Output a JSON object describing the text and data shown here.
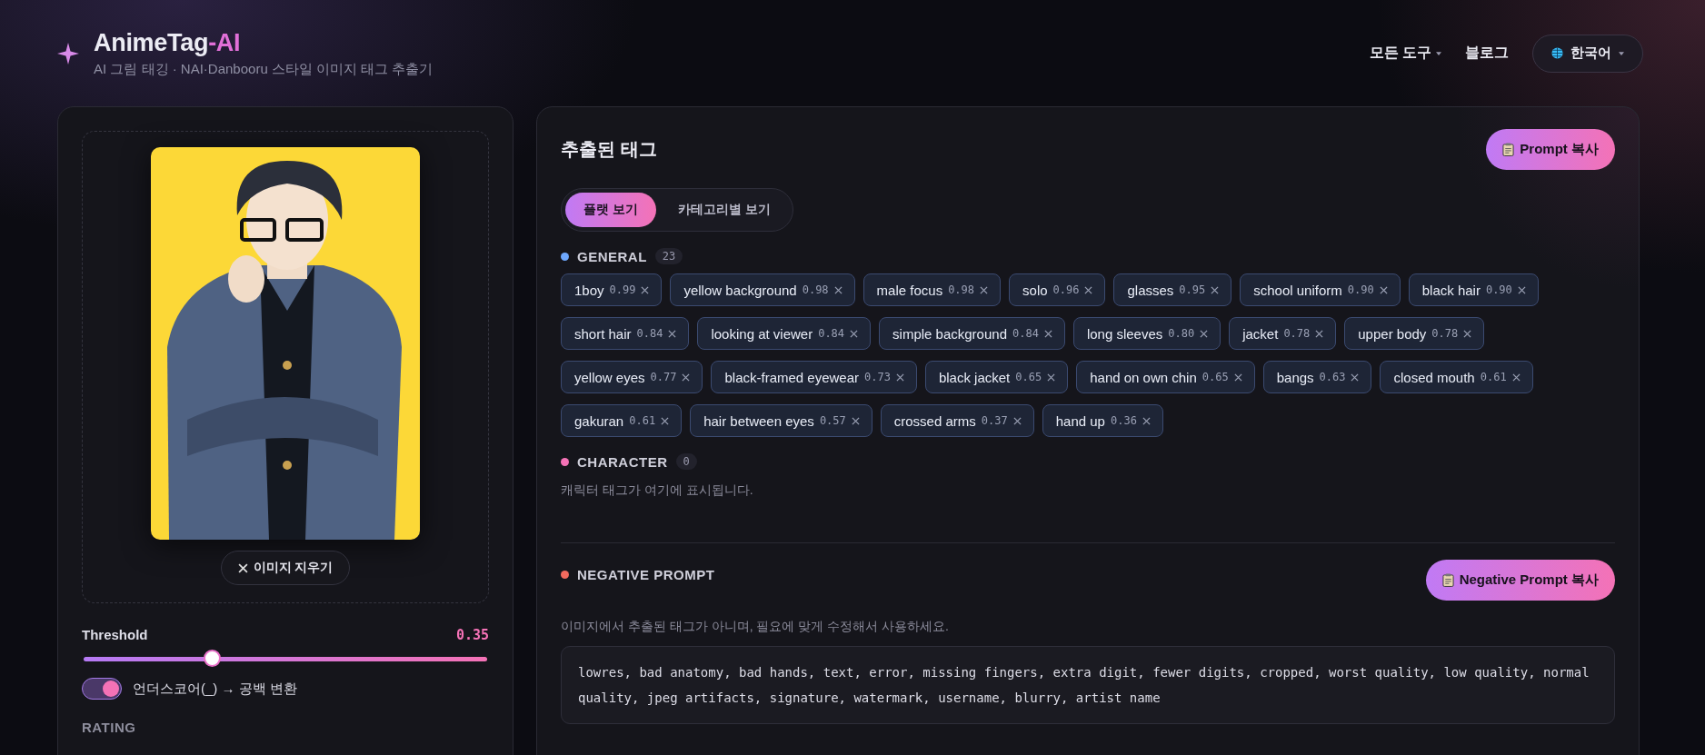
{
  "header": {
    "logo_prefix": "AnimeTag",
    "logo_suffix": "-AI",
    "subtitle": "AI 그림 태깅 · NAI·Danbooru 스타일 이미지 태그 추출기",
    "nav": [
      {
        "label": "모든 도구",
        "kind": "dropdown"
      },
      {
        "label": "블로그",
        "kind": "link"
      }
    ],
    "language": "한국어"
  },
  "image_panel": {
    "clear_button": "이미지 지우기",
    "threshold": {
      "label": "Threshold",
      "value": "0.35",
      "level": 0.32
    },
    "underscore_toggle": {
      "label": "언더스코어(_) → 공백 변환",
      "on": true
    },
    "rating_heading": "RATING"
  },
  "tags_panel": {
    "title": "추출된 태그",
    "copy_button": "Prompt 복사",
    "views": [
      {
        "label": "플랫 보기",
        "selected": true
      },
      {
        "label": "카테고리별 보기",
        "selected": false
      }
    ],
    "categories": [
      {
        "name": "GENERAL",
        "color": "#6ea8fe",
        "count": "23",
        "tags": [
          {
            "name": "1boy",
            "score": "0.99"
          },
          {
            "name": "yellow background",
            "score": "0.98"
          },
          {
            "name": "male focus",
            "score": "0.98"
          },
          {
            "name": "solo",
            "score": "0.96"
          },
          {
            "name": "glasses",
            "score": "0.95"
          },
          {
            "name": "school uniform",
            "score": "0.90"
          },
          {
            "name": "black hair",
            "score": "0.90"
          },
          {
            "name": "short hair",
            "score": "0.84"
          },
          {
            "name": "looking at viewer",
            "score": "0.84"
          },
          {
            "name": "simple background",
            "score": "0.84"
          },
          {
            "name": "long sleeves",
            "score": "0.80"
          },
          {
            "name": "jacket",
            "score": "0.78"
          },
          {
            "name": "upper body",
            "score": "0.78"
          },
          {
            "name": "yellow eyes",
            "score": "0.77"
          },
          {
            "name": "black-framed eyewear",
            "score": "0.73"
          },
          {
            "name": "black jacket",
            "score": "0.65"
          },
          {
            "name": "hand on own chin",
            "score": "0.65"
          },
          {
            "name": "bangs",
            "score": "0.63"
          },
          {
            "name": "closed mouth",
            "score": "0.61"
          },
          {
            "name": "gakuran",
            "score": "0.61"
          },
          {
            "name": "hair between eyes",
            "score": "0.57"
          },
          {
            "name": "crossed arms",
            "score": "0.37"
          },
          {
            "name": "hand up",
            "score": "0.36"
          }
        ]
      },
      {
        "name": "CHARACTER",
        "color": "#f472b6",
        "count": "0",
        "empty_text": "캐릭터 태그가 여기에 표시됩니다."
      }
    ],
    "negative": {
      "title": "NEGATIVE PROMPT",
      "color": "#f26a5e",
      "copy_button": "Negative Prompt 복사",
      "hint": "이미지에서 추출된 태그가 아니며, 필요에 맞게 수정해서 사용하세요.",
      "text": "lowres, bad anatomy, bad hands, text, error, missing fingers, extra digit, fewer digits, cropped, worst quality, low quality, normal quality, jpeg artifacts, signature, watermark, username, blurry, artist name"
    }
  }
}
